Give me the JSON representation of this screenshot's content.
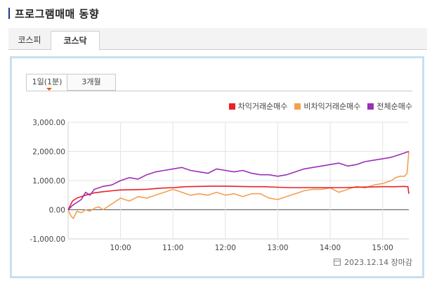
{
  "header": {
    "title": "프로그램매매 동향"
  },
  "tabs": [
    {
      "label": "코스피"
    },
    {
      "label": "코스닥"
    }
  ],
  "subtabs": [
    {
      "label": "1일(1분)"
    },
    {
      "label": "3개월"
    }
  ],
  "legend": [
    {
      "label": "차익거래순매수",
      "color": "#e8202a"
    },
    {
      "label": "비차익거래순매수",
      "color": "#f4a050"
    },
    {
      "label": "전체순매수",
      "color": "#9b30b8"
    }
  ],
  "footer": {
    "date": "2023.12.14",
    "status": "장마감"
  },
  "chart_data": {
    "type": "line",
    "xlabel": "",
    "ylabel": "",
    "ylim": [
      -1000,
      3000
    ],
    "y_ticks": [
      "3,000.00",
      "2,000.00",
      "1,000.00",
      "0.00",
      "-1,000.00"
    ],
    "y_tick_values": [
      3000,
      2000,
      1000,
      0,
      -1000
    ],
    "x_ticks": [
      "10:00",
      "11:00",
      "12:00",
      "13:00",
      "14:00",
      "15:00"
    ],
    "x_range_minutes": [
      540,
      930
    ],
    "x_tick_minutes": [
      600,
      660,
      720,
      780,
      840,
      900
    ],
    "grid": true,
    "legend_position": "top-right",
    "series": [
      {
        "name": "차익거래순매수",
        "color": "#e8202a",
        "x": [
          540,
          545,
          550,
          555,
          560,
          570,
          580,
          590,
          600,
          615,
          630,
          645,
          660,
          675,
          690,
          705,
          720,
          735,
          750,
          765,
          780,
          795,
          810,
          825,
          840,
          855,
          870,
          885,
          900,
          915,
          925,
          929,
          930
        ],
        "values": [
          0,
          300,
          400,
          450,
          500,
          580,
          620,
          650,
          680,
          690,
          700,
          740,
          760,
          790,
          800,
          810,
          810,
          800,
          790,
          790,
          770,
          760,
          760,
          760,
          760,
          760,
          770,
          780,
          790,
          790,
          800,
          790,
          550
        ]
      },
      {
        "name": "비차익거래순매수",
        "color": "#f4a050",
        "x": [
          540,
          543,
          546,
          550,
          555,
          560,
          565,
          570,
          575,
          580,
          590,
          600,
          610,
          620,
          630,
          640,
          650,
          660,
          670,
          680,
          690,
          700,
          710,
          720,
          730,
          740,
          750,
          760,
          770,
          780,
          790,
          800,
          810,
          820,
          830,
          840,
          850,
          860,
          870,
          880,
          890,
          900,
          910,
          915,
          920,
          925,
          928,
          930
        ],
        "values": [
          0,
          -200,
          -300,
          -50,
          -100,
          0,
          -50,
          50,
          100,
          0,
          200,
          400,
          300,
          450,
          400,
          500,
          600,
          700,
          600,
          500,
          550,
          500,
          600,
          500,
          550,
          450,
          550,
          550,
          400,
          350,
          450,
          550,
          650,
          700,
          700,
          750,
          600,
          700,
          800,
          750,
          850,
          900,
          1000,
          1100,
          1150,
          1150,
          1250,
          2000
        ]
      },
      {
        "name": "전체순매수",
        "color": "#9b30b8",
        "x": [
          540,
          545,
          550,
          555,
          560,
          565,
          570,
          575,
          580,
          590,
          600,
          610,
          620,
          630,
          640,
          650,
          660,
          670,
          680,
          690,
          700,
          710,
          720,
          730,
          740,
          750,
          760,
          770,
          780,
          790,
          800,
          810,
          820,
          830,
          840,
          850,
          860,
          870,
          880,
          890,
          900,
          910,
          920,
          925,
          930
        ],
        "values": [
          0,
          150,
          250,
          350,
          600,
          500,
          700,
          750,
          800,
          850,
          1000,
          1100,
          1050,
          1200,
          1300,
          1350,
          1400,
          1450,
          1350,
          1300,
          1250,
          1400,
          1350,
          1300,
          1350,
          1250,
          1200,
          1200,
          1150,
          1200,
          1300,
          1400,
          1450,
          1500,
          1550,
          1600,
          1500,
          1550,
          1650,
          1700,
          1750,
          1800,
          1900,
          1950,
          2000
        ]
      }
    ]
  }
}
